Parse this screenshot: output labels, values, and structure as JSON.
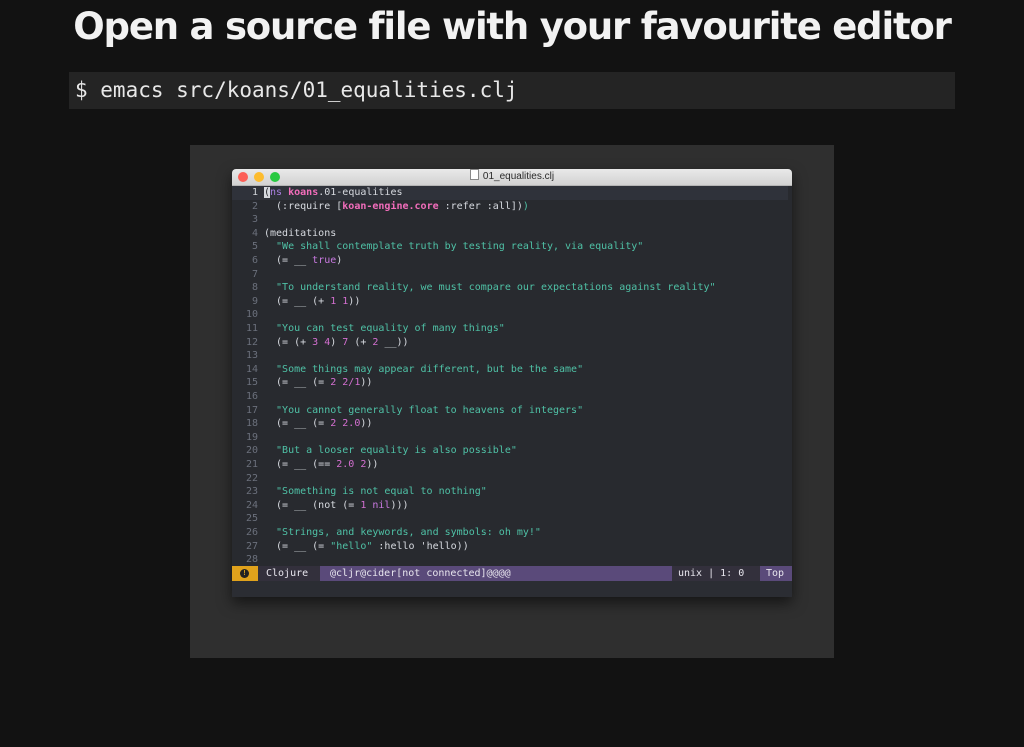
{
  "heading": "Open a source file with your favourite editor",
  "command": "$ emacs src/koans/01_equalities.clj",
  "window": {
    "title": "01_equalities.clj",
    "traffic_lights": [
      "close",
      "minimize",
      "zoom"
    ]
  },
  "code_lines": [
    {
      "n": "1",
      "current": true,
      "tokens": [
        [
          "cursor",
          "("
        ],
        [
          "kw",
          "ns"
        ],
        [
          "plain",
          " "
        ],
        [
          "ns",
          "koans"
        ],
        [
          "plain",
          ".01-equalities"
        ]
      ]
    },
    {
      "n": "2",
      "tokens": [
        [
          "plain",
          "  (:require ["
        ],
        [
          "ns",
          "koan-engine.core"
        ],
        [
          "plain",
          " :refer :all])"
        ],
        [
          "str",
          ")"
        ]
      ]
    },
    {
      "n": "3",
      "tokens": []
    },
    {
      "n": "4",
      "tokens": [
        [
          "plain",
          "(meditations"
        ]
      ]
    },
    {
      "n": "5",
      "tokens": [
        [
          "str",
          "  \"We shall contemplate truth by testing reality, via equality\""
        ]
      ]
    },
    {
      "n": "6",
      "tokens": [
        [
          "plain",
          "  (= __ "
        ],
        [
          "vb",
          "true"
        ],
        [
          "plain",
          ")"
        ]
      ]
    },
    {
      "n": "7",
      "tokens": []
    },
    {
      "n": "8",
      "tokens": [
        [
          "str",
          "  \"To understand reality, we must compare our expectations against reality\""
        ]
      ]
    },
    {
      "n": "9",
      "tokens": [
        [
          "plain",
          "  (= __ (+ "
        ],
        [
          "nb",
          "1 1"
        ],
        [
          "plain",
          "))"
        ]
      ]
    },
    {
      "n": "10",
      "tokens": []
    },
    {
      "n": "11",
      "tokens": [
        [
          "str",
          "  \"You can test equality of many things\""
        ]
      ]
    },
    {
      "n": "12",
      "tokens": [
        [
          "plain",
          "  (= (+ "
        ],
        [
          "nb",
          "3 4"
        ],
        [
          "plain",
          ") "
        ],
        [
          "nb",
          "7"
        ],
        [
          "plain",
          " (+ "
        ],
        [
          "nb",
          "2"
        ],
        [
          "plain",
          " __))"
        ]
      ]
    },
    {
      "n": "13",
      "tokens": []
    },
    {
      "n": "14",
      "tokens": [
        [
          "str",
          "  \"Some things may appear different, but be the same\""
        ]
      ]
    },
    {
      "n": "15",
      "tokens": [
        [
          "plain",
          "  (= __ (= "
        ],
        [
          "nb",
          "2 2/1"
        ],
        [
          "plain",
          "))"
        ]
      ]
    },
    {
      "n": "16",
      "tokens": []
    },
    {
      "n": "17",
      "tokens": [
        [
          "str",
          "  \"You cannot generally float to heavens of integers\""
        ]
      ]
    },
    {
      "n": "18",
      "tokens": [
        [
          "plain",
          "  (= __ (= "
        ],
        [
          "nb",
          "2 2.0"
        ],
        [
          "plain",
          "))"
        ]
      ]
    },
    {
      "n": "19",
      "tokens": []
    },
    {
      "n": "20",
      "tokens": [
        [
          "str",
          "  \"But a looser equality is also possible\""
        ]
      ]
    },
    {
      "n": "21",
      "tokens": [
        [
          "plain",
          "  (= __ (== "
        ],
        [
          "nb",
          "2.0 2"
        ],
        [
          "plain",
          "))"
        ]
      ]
    },
    {
      "n": "22",
      "tokens": []
    },
    {
      "n": "23",
      "tokens": [
        [
          "str",
          "  \"Something is not equal to nothing\""
        ]
      ]
    },
    {
      "n": "24",
      "tokens": [
        [
          "plain",
          "  (= __ (not (= "
        ],
        [
          "nb",
          "1"
        ],
        [
          "plain",
          " "
        ],
        [
          "vb",
          "nil"
        ],
        [
          "plain",
          ")))"
        ]
      ]
    },
    {
      "n": "25",
      "tokens": []
    },
    {
      "n": "26",
      "tokens": [
        [
          "str",
          "  \"Strings, and keywords, and symbols: oh my!\""
        ]
      ]
    },
    {
      "n": "27",
      "tokens": [
        [
          "plain",
          "  (= __ (= "
        ],
        [
          "str",
          "\"hello\""
        ],
        [
          "plain",
          " :hello 'hello))"
        ]
      ]
    },
    {
      "n": "28",
      "tokens": []
    }
  ],
  "modeline": {
    "warning_icon": "warning-icon",
    "major_mode": "Clojure",
    "minor_modes": "@cljr@cider[not connected]@@@@",
    "encoding": "unix | 1: 0",
    "position": "Top"
  },
  "colors": {
    "background": "#121212",
    "editor_bg": "#282a2f",
    "string": "#4fc1a6",
    "keyword": "#a87fe0",
    "namespace": "#f26dbb",
    "number": "#d36fd0",
    "modeline_bg": "#5a4a7a",
    "modeline_warning": "#e0a21c"
  }
}
